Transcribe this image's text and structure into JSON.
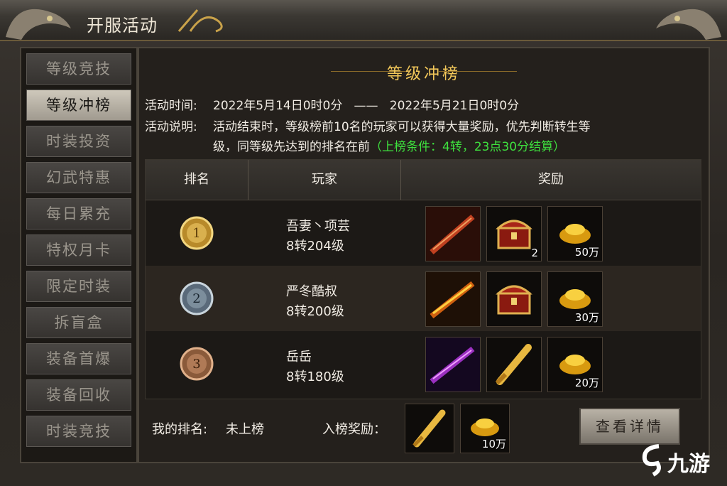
{
  "window": {
    "title": "开服活动"
  },
  "sidebar": {
    "items": [
      {
        "label": "等级竞技",
        "active": false
      },
      {
        "label": "等级冲榜",
        "active": true
      },
      {
        "label": "时装投资",
        "active": false
      },
      {
        "label": "幻武特惠",
        "active": false
      },
      {
        "label": "每日累充",
        "active": false
      },
      {
        "label": "特权月卡",
        "active": false
      },
      {
        "label": "限定时装",
        "active": false
      },
      {
        "label": "拆盲盒",
        "active": false
      },
      {
        "label": "装备首爆",
        "active": false
      },
      {
        "label": "装备回收",
        "active": false
      },
      {
        "label": "时装竞技",
        "active": false
      }
    ]
  },
  "main": {
    "heading": "等级冲榜",
    "time_label": "活动时间:",
    "time_value": "2022年5月14日0时0分   ——   2022年5月21日0时0分",
    "desc_label": "活动说明:",
    "desc_line1": "活动结束时，等级榜前10名的玩家可以获得大量奖励，优先判断转生等",
    "desc_line2": "级，同等级先达到的排名在前",
    "desc_condition": "（上榜条件：4转，23点30分结算）"
  },
  "table": {
    "headers": {
      "rank": "排名",
      "player": "玩家",
      "reward": "奖励"
    },
    "rows": [
      {
        "rank": "1",
        "name": "吾妻丶项芸",
        "level": "8转204级",
        "rewards": [
          {
            "icon": "sword-item-icon",
            "qty": ""
          },
          {
            "icon": "treasure-chest-icon",
            "qty": "2"
          },
          {
            "icon": "gold-ingot-icon",
            "qty": "50万"
          }
        ]
      },
      {
        "rank": "2",
        "name": "严冬酷叔",
        "level": "8转200级",
        "rewards": [
          {
            "icon": "flame-sword-icon",
            "qty": ""
          },
          {
            "icon": "treasure-chest-icon",
            "qty": ""
          },
          {
            "icon": "gold-ingot-icon",
            "qty": "30万"
          }
        ]
      },
      {
        "rank": "3",
        "name": "岳岳",
        "level": "8转180级",
        "rewards": [
          {
            "icon": "purple-sword-icon",
            "qty": ""
          },
          {
            "icon": "scroll-icon",
            "qty": ""
          },
          {
            "icon": "gold-ingot-icon",
            "qty": "20万"
          }
        ]
      }
    ]
  },
  "footer": {
    "my_rank_label": "我的排名:",
    "my_rank_value": "未上榜",
    "entry_reward_label": "入榜奖励：",
    "entry_rewards": [
      {
        "icon": "scroll-icon",
        "qty": ""
      },
      {
        "icon": "gold-ingot-icon",
        "qty": "10万"
      }
    ],
    "detail_button": "查看详情"
  },
  "watermark": {
    "text": "九游"
  },
  "colors": {
    "accent_gold": "#f3c85a",
    "condition_green": "#3ee03e",
    "active_tab": "#cfc9bc"
  }
}
